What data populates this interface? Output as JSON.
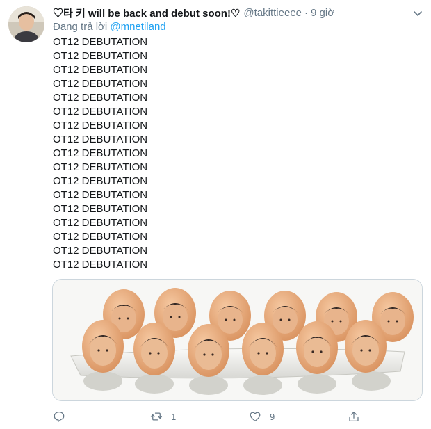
{
  "tweet": {
    "display_name": "♡타 키 will be back and debut soon!♡",
    "handle": "@takittieeee",
    "separator": "·",
    "time": "9 giờ",
    "reply_prefix": "Đang trả lời ",
    "reply_mention": "@mnetiland",
    "lines": [
      "OT12 DEBUTATION",
      "OT12 DEBUTATION",
      "OT12 DEBUTATION",
      "OT12 DEBUTATION",
      "OT12 DEBUTATION",
      "OT12 DEBUTATION",
      "OT12 DEBUTATION",
      "OT12 DEBUTATION",
      "OT12 DEBUTATION",
      "OT12 DEBUTATION",
      "OT12 DEBUTATION",
      "OT12 DEBUTATION",
      "OT12 DEBUTATION",
      "OT12 DEBUTATION",
      "OT12 DEBUTATION",
      "OT12 DEBUTATION",
      "OT12 DEBUTATION"
    ],
    "media": {
      "description_icon": "egg-carton-photo",
      "egg_count": 12
    }
  },
  "actions": {
    "reply": {
      "icon": "reply-icon",
      "count": ""
    },
    "retweet": {
      "icon": "retweet-icon",
      "count": "1"
    },
    "like": {
      "icon": "heart-icon",
      "count": "9"
    },
    "share": {
      "icon": "share-icon",
      "count": ""
    }
  },
  "colors": {
    "text": "#14171a",
    "muted": "#657786",
    "link": "#1da1f2",
    "border": "#ccd6dd"
  }
}
